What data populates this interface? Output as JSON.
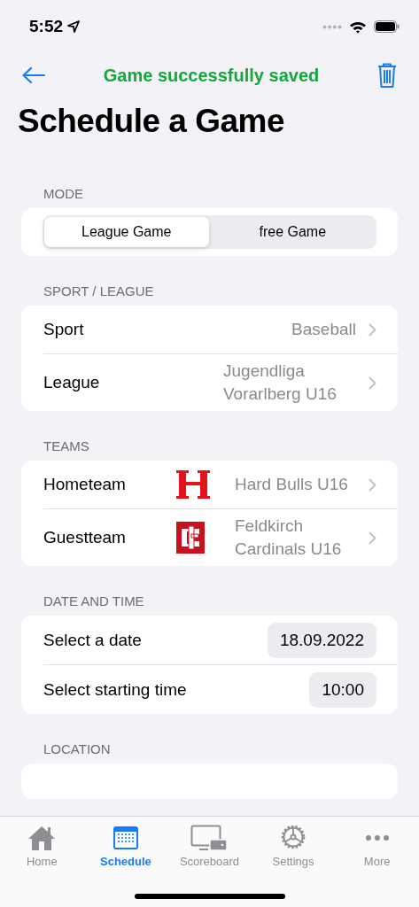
{
  "status_bar": {
    "time": "5:52"
  },
  "nav": {
    "title": "Game successfully saved"
  },
  "page_title": "Schedule a Game",
  "sections": [
    {
      "header": "MODE",
      "kind": "segmented",
      "segments": [
        {
          "label": "League Game",
          "selected": true
        },
        {
          "label": "free Game",
          "selected": false
        }
      ]
    },
    {
      "header": "SPORT / LEAGUE",
      "kind": "list",
      "rows": [
        {
          "label": "Sport",
          "value": "Baseball"
        },
        {
          "label": "League",
          "value": "Jugendliga Vorarlberg U16"
        }
      ]
    },
    {
      "header": "TEAMS",
      "kind": "teams",
      "rows": [
        {
          "label": "Hometeam",
          "value": "Hard Bulls U16"
        },
        {
          "label": "Guestteam",
          "value": "Feldkirch Cardinals U16"
        }
      ]
    },
    {
      "header": "DATE AND TIME",
      "kind": "pickers",
      "rows": [
        {
          "label": "Select a date",
          "value": "18.09.2022"
        },
        {
          "label": "Select starting time",
          "value": "10:00"
        }
      ]
    },
    {
      "header": "LOCATION",
      "kind": "empty"
    }
  ],
  "tab_bar": [
    {
      "label": "Home",
      "selected": false
    },
    {
      "label": "Schedule",
      "selected": true
    },
    {
      "label": "Scoreboard",
      "selected": false
    },
    {
      "label": "Settings",
      "selected": false
    },
    {
      "label": "More",
      "selected": false
    }
  ]
}
